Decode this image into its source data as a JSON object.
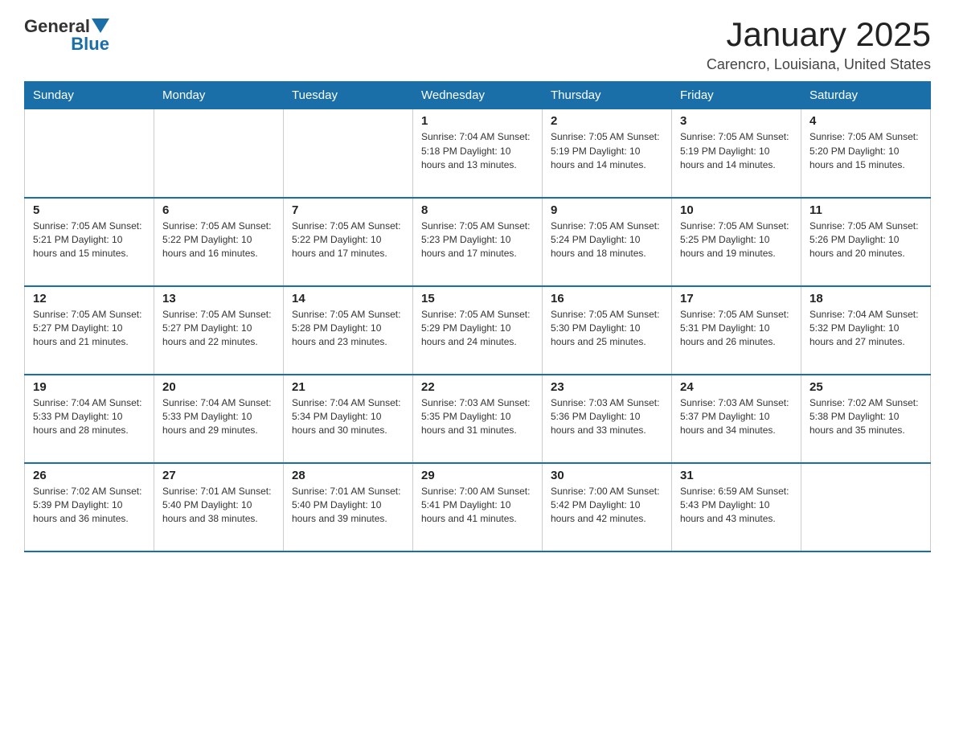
{
  "logo": {
    "general": "General",
    "blue": "Blue"
  },
  "header": {
    "title": "January 2025",
    "subtitle": "Carencro, Louisiana, United States"
  },
  "days_of_week": [
    "Sunday",
    "Monday",
    "Tuesday",
    "Wednesday",
    "Thursday",
    "Friday",
    "Saturday"
  ],
  "weeks": [
    [
      {
        "day": "",
        "info": ""
      },
      {
        "day": "",
        "info": ""
      },
      {
        "day": "",
        "info": ""
      },
      {
        "day": "1",
        "info": "Sunrise: 7:04 AM\nSunset: 5:18 PM\nDaylight: 10 hours\nand 13 minutes."
      },
      {
        "day": "2",
        "info": "Sunrise: 7:05 AM\nSunset: 5:19 PM\nDaylight: 10 hours\nand 14 minutes."
      },
      {
        "day": "3",
        "info": "Sunrise: 7:05 AM\nSunset: 5:19 PM\nDaylight: 10 hours\nand 14 minutes."
      },
      {
        "day": "4",
        "info": "Sunrise: 7:05 AM\nSunset: 5:20 PM\nDaylight: 10 hours\nand 15 minutes."
      }
    ],
    [
      {
        "day": "5",
        "info": "Sunrise: 7:05 AM\nSunset: 5:21 PM\nDaylight: 10 hours\nand 15 minutes."
      },
      {
        "day": "6",
        "info": "Sunrise: 7:05 AM\nSunset: 5:22 PM\nDaylight: 10 hours\nand 16 minutes."
      },
      {
        "day": "7",
        "info": "Sunrise: 7:05 AM\nSunset: 5:22 PM\nDaylight: 10 hours\nand 17 minutes."
      },
      {
        "day": "8",
        "info": "Sunrise: 7:05 AM\nSunset: 5:23 PM\nDaylight: 10 hours\nand 17 minutes."
      },
      {
        "day": "9",
        "info": "Sunrise: 7:05 AM\nSunset: 5:24 PM\nDaylight: 10 hours\nand 18 minutes."
      },
      {
        "day": "10",
        "info": "Sunrise: 7:05 AM\nSunset: 5:25 PM\nDaylight: 10 hours\nand 19 minutes."
      },
      {
        "day": "11",
        "info": "Sunrise: 7:05 AM\nSunset: 5:26 PM\nDaylight: 10 hours\nand 20 minutes."
      }
    ],
    [
      {
        "day": "12",
        "info": "Sunrise: 7:05 AM\nSunset: 5:27 PM\nDaylight: 10 hours\nand 21 minutes."
      },
      {
        "day": "13",
        "info": "Sunrise: 7:05 AM\nSunset: 5:27 PM\nDaylight: 10 hours\nand 22 minutes."
      },
      {
        "day": "14",
        "info": "Sunrise: 7:05 AM\nSunset: 5:28 PM\nDaylight: 10 hours\nand 23 minutes."
      },
      {
        "day": "15",
        "info": "Sunrise: 7:05 AM\nSunset: 5:29 PM\nDaylight: 10 hours\nand 24 minutes."
      },
      {
        "day": "16",
        "info": "Sunrise: 7:05 AM\nSunset: 5:30 PM\nDaylight: 10 hours\nand 25 minutes."
      },
      {
        "day": "17",
        "info": "Sunrise: 7:05 AM\nSunset: 5:31 PM\nDaylight: 10 hours\nand 26 minutes."
      },
      {
        "day": "18",
        "info": "Sunrise: 7:04 AM\nSunset: 5:32 PM\nDaylight: 10 hours\nand 27 minutes."
      }
    ],
    [
      {
        "day": "19",
        "info": "Sunrise: 7:04 AM\nSunset: 5:33 PM\nDaylight: 10 hours\nand 28 minutes."
      },
      {
        "day": "20",
        "info": "Sunrise: 7:04 AM\nSunset: 5:33 PM\nDaylight: 10 hours\nand 29 minutes."
      },
      {
        "day": "21",
        "info": "Sunrise: 7:04 AM\nSunset: 5:34 PM\nDaylight: 10 hours\nand 30 minutes."
      },
      {
        "day": "22",
        "info": "Sunrise: 7:03 AM\nSunset: 5:35 PM\nDaylight: 10 hours\nand 31 minutes."
      },
      {
        "day": "23",
        "info": "Sunrise: 7:03 AM\nSunset: 5:36 PM\nDaylight: 10 hours\nand 33 minutes."
      },
      {
        "day": "24",
        "info": "Sunrise: 7:03 AM\nSunset: 5:37 PM\nDaylight: 10 hours\nand 34 minutes."
      },
      {
        "day": "25",
        "info": "Sunrise: 7:02 AM\nSunset: 5:38 PM\nDaylight: 10 hours\nand 35 minutes."
      }
    ],
    [
      {
        "day": "26",
        "info": "Sunrise: 7:02 AM\nSunset: 5:39 PM\nDaylight: 10 hours\nand 36 minutes."
      },
      {
        "day": "27",
        "info": "Sunrise: 7:01 AM\nSunset: 5:40 PM\nDaylight: 10 hours\nand 38 minutes."
      },
      {
        "day": "28",
        "info": "Sunrise: 7:01 AM\nSunset: 5:40 PM\nDaylight: 10 hours\nand 39 minutes."
      },
      {
        "day": "29",
        "info": "Sunrise: 7:00 AM\nSunset: 5:41 PM\nDaylight: 10 hours\nand 41 minutes."
      },
      {
        "day": "30",
        "info": "Sunrise: 7:00 AM\nSunset: 5:42 PM\nDaylight: 10 hours\nand 42 minutes."
      },
      {
        "day": "31",
        "info": "Sunrise: 6:59 AM\nSunset: 5:43 PM\nDaylight: 10 hours\nand 43 minutes."
      },
      {
        "day": "",
        "info": ""
      }
    ]
  ]
}
